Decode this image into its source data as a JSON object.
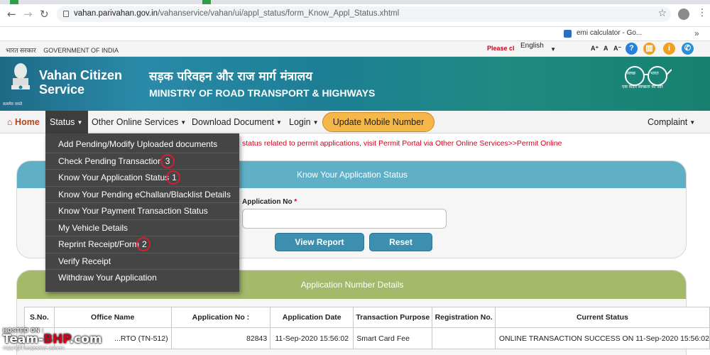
{
  "browser": {
    "url_host": "vahan.parivahan.gov.in",
    "url_path": "/vahanservice/vahan/ui/appl_status/form_Know_Appl_Status.xhtml",
    "bookmark_label": "emi calculator - Go..."
  },
  "gov_strip": {
    "hindi": "भारत सरकार",
    "english": "GOVERNMENT OF INDIA",
    "ticker": "Please clic",
    "language": "English",
    "font_controls": [
      "A⁺",
      "A",
      "A⁻"
    ]
  },
  "header": {
    "site_title_line1": "Vahan Citizen",
    "site_title_line2": "Service",
    "emblem_caption": "सत्यमेव जयते",
    "ministry_hindi": "सड़क परिवहन और राज मार्ग मंत्रालय",
    "ministry_english": "MINISTRY OF ROAD TRANSPORT & HIGHWAYS",
    "swachh_caption": "एक कदम स्वच्छता की ओर",
    "swachh_words": [
      "स्वच्छ",
      "भारत"
    ]
  },
  "navbar": {
    "home": "Home",
    "status": "Status",
    "other_services": "Other Online Services",
    "download": "Download Document",
    "login": "Login",
    "update_mobile": "Update Mobile Number",
    "complaint": "Complaint"
  },
  "status_menu": [
    {
      "label": "Add Pending/Modify Uploaded documents",
      "marker": ""
    },
    {
      "label": "Check Pending Transaction",
      "marker": "3"
    },
    {
      "label": "Know Your Application Status",
      "marker": "1"
    },
    {
      "label": "Know Your Pending eChallan/Blacklist Details",
      "marker": ""
    },
    {
      "label": "Know Your Payment Transaction Status",
      "marker": ""
    },
    {
      "label": "My Vehicle Details",
      "marker": ""
    },
    {
      "label": "Reprint Receipt/Form",
      "marker": "2"
    },
    {
      "label": "Verify Receipt",
      "marker": ""
    },
    {
      "label": "Withdraw Your Application",
      "marker": ""
    }
  ],
  "notice": "status related to permit applications, visit Permit Portal via Other Online Services>>Permit Online",
  "status_panel": {
    "title": "Know Your Application Status",
    "app_no_label": "Application No",
    "required_mark": "*",
    "app_no_value": "",
    "view_report": "View Report",
    "reset": "Reset"
  },
  "details_panel": {
    "title": "Application Number Details",
    "columns": [
      "S.No.",
      "Office Name",
      "Application No :",
      "Application Date",
      "Transaction Purpose",
      "Registration No.",
      "Current Status"
    ],
    "rows": [
      [
        "",
        "...RTO (TN-512)",
        "82843",
        "11-Sep-2020 15:56:02",
        "Smart Card Fee",
        "",
        "ONLINE TRANSACTION SUCCESS ON 11-Sep-2020 15:56:02"
      ]
    ]
  },
  "watermark": {
    "hosted": "HOSTED ON :",
    "brand_a": "Team-",
    "brand_b": "BHP",
    "brand_c": ".com",
    "copyright": "copyright respective owners"
  },
  "colors": {
    "banner": "#1e7f95",
    "status_panel_header": "#5fafc7",
    "details_panel_header": "#a4b96a",
    "update_button": "#f6b74a",
    "menu_bg": "#454545",
    "annotation_ring": "#d11f2d"
  }
}
